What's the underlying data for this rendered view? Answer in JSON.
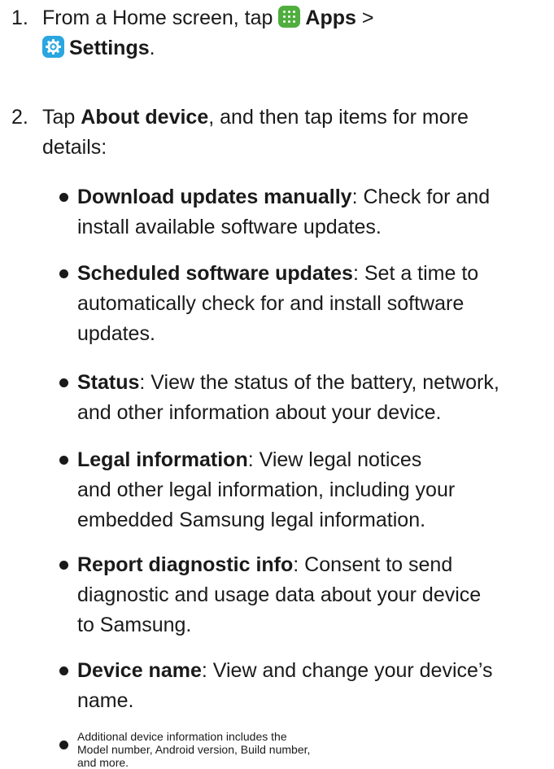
{
  "steps": [
    {
      "number": "1.",
      "line1_prefix": "From a Home screen, tap",
      "apps_label": "Apps",
      "separator": ">",
      "settings_label": "Settings",
      "line2_suffix": "."
    },
    {
      "number": "2.",
      "prefix": "Tap",
      "bold": "About device",
      "suffix": ", and then tap items for more",
      "line2": "details:"
    }
  ],
  "icons": {
    "apps": "apps-icon",
    "settings": "settings-gear-icon",
    "apps_color": "#4fae3e",
    "settings_color": "#2aa6e0"
  },
  "items": [
    {
      "bold": "Download updates manually",
      "line1_rest": ": Check for and",
      "lines": [
        "install available software updates."
      ]
    },
    {
      "bold": "Scheduled software updates",
      "line1_rest": ": Set a time to",
      "lines": [
        "automatically check for and install software",
        "updates."
      ]
    },
    {
      "bold": "Status",
      "line1_rest": ": View the status of the battery, network,",
      "lines": [
        "and other information about your device."
      ]
    },
    {
      "bold": "Legal information",
      "line1_rest": ": View legal notices",
      "lines": [
        "and other legal information, including your",
        "embedded Samsung legal information."
      ]
    },
    {
      "bold": "Report diagnostic info",
      "line1_rest": ": Consent to send",
      "lines": [
        "diagnostic and usage data about your device",
        "to Samsung."
      ]
    },
    {
      "bold": "Device name",
      "line1_rest": ": View and change your device’s",
      "lines": [
        "name."
      ]
    },
    {
      "bold": "",
      "line1_rest": "Additional device information includes the",
      "lines": [
        "Model number, Android version, Build number,",
        "and more."
      ]
    }
  ]
}
